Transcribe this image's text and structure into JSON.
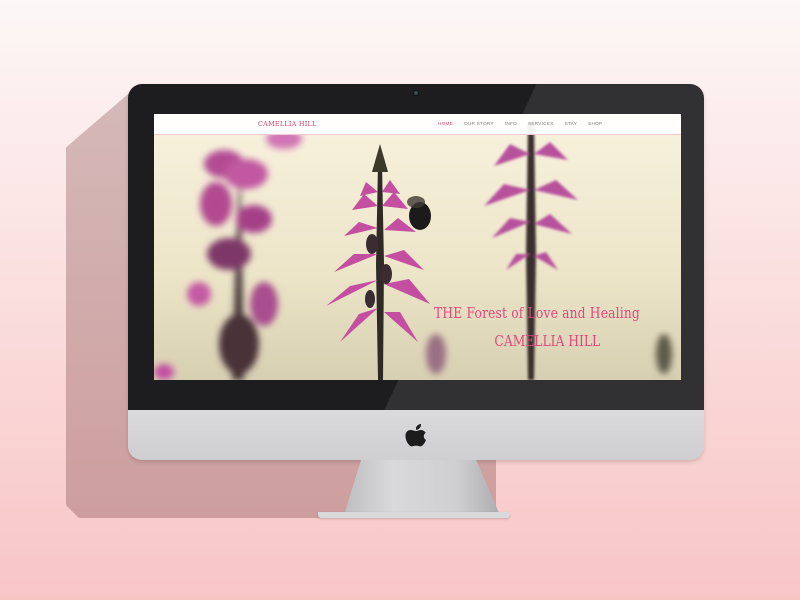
{
  "website": {
    "brand": "CAMELLIA HILL",
    "nav": [
      {
        "label": "HOME",
        "active": true
      },
      {
        "label": "OUR STORY",
        "active": false
      },
      {
        "label": "INFO",
        "active": false
      },
      {
        "label": "SERVICES",
        "active": false
      },
      {
        "label": "STAY",
        "active": false
      },
      {
        "label": "SHOP",
        "active": false
      }
    ],
    "hero": {
      "tagline": "THE Forest of Love and Healing",
      "title": "CAMELLIA HILL"
    }
  },
  "device": {
    "logo_icon": "apple-logo-icon"
  },
  "colors": {
    "accent": "#e2467f",
    "flower": "#c44fa0",
    "background_top": "#fdf7f7",
    "background_bottom": "#f8c5c5"
  }
}
